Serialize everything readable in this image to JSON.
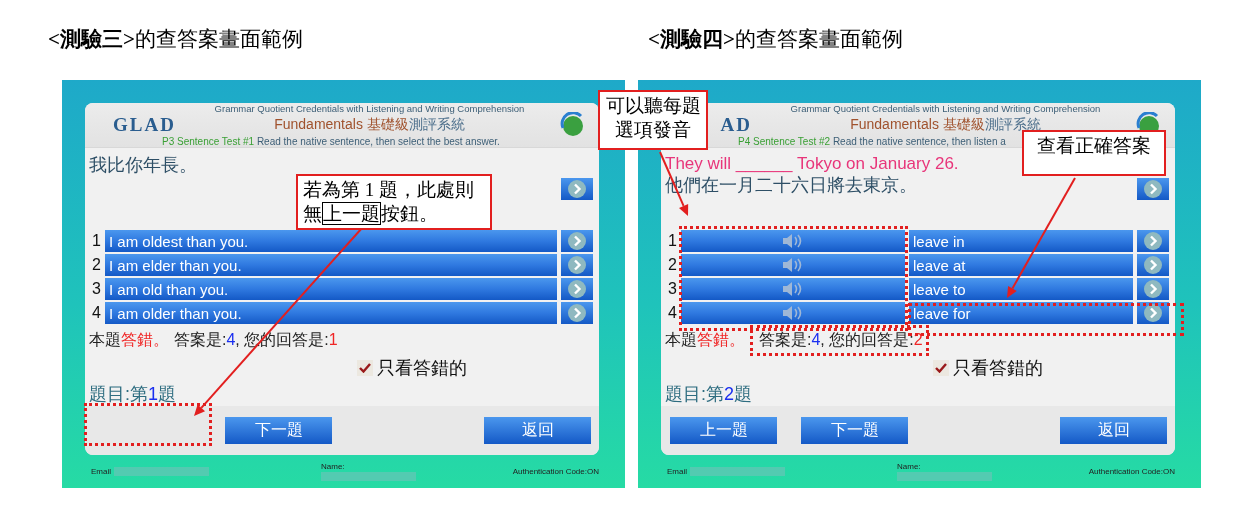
{
  "panels": [
    {
      "heading": "**<測驗三>**的查答案畫面範例",
      "app": {
        "logo": "GLAD",
        "header_line": "Grammar Quotient Credentials with Listening and Writing Comprehension",
        "title_main": "Fundamentals 基礎級",
        "title_rest": "測評系統",
        "test_name": "P3 Sentence Test #1",
        "instruction": "Read the native sentence, then select the best answer."
      },
      "question": {
        "translation": "我比你年長。"
      },
      "options": [
        {
          "number": "1",
          "text": "I am oldest than you.",
          "kind": "text"
        },
        {
          "number": "2",
          "text": "I am elder than you.",
          "kind": "text"
        },
        {
          "number": "3",
          "text": "I am old than you.",
          "kind": "text"
        },
        {
          "number": "4",
          "text": "I am older than you.",
          "kind": "text"
        }
      ],
      "result": {
        "prefix": "本題",
        "verdict": "答錯。",
        "answer_label": "答案是:",
        "answer": "4",
        "response_label": ", 您的回答是:",
        "response": "1"
      },
      "filter": {
        "label": "只看答錯的",
        "checked": true
      },
      "progress": {
        "label": "題目:第",
        "number": "1",
        "suffix": "題"
      },
      "buttons": [
        {
          "label": "下一題",
          "kind": "next"
        },
        {
          "label": "返回",
          "kind": "back"
        }
      ],
      "footer": {
        "email_label": "Email",
        "name_label": "Name:",
        "auth": "Authentication Code:ON"
      },
      "callouts": [
        {
          "parts": [
            {
              "text": "若為第 1 題，此處則無",
              "boxed": false
            },
            {
              "text": "上一題",
              "boxed": true
            },
            {
              "text": "按鈕。",
              "boxed": false
            }
          ]
        }
      ]
    },
    {
      "heading": "**<測驗四>**的查答案畫面範例",
      "app": {
        "logo": "AD",
        "header_line": "Grammar Quotient Credentials with Listening and Writing Comprehension",
        "title_main": "Fundamentals 基礎級",
        "title_rest": "測評系統",
        "test_name": "P4 Sentence Test #2",
        "instruction": "Read the native sentence, then listen a"
      },
      "question": {
        "sentence": "They will ______ Tokyo on January 26.",
        "translation": "他們在一月二十六日將去東京。"
      },
      "options": [
        {
          "number": "1",
          "text": "leave in",
          "kind": "audio"
        },
        {
          "number": "2",
          "text": "leave at",
          "kind": "audio"
        },
        {
          "number": "3",
          "text": "leave to",
          "kind": "audio"
        },
        {
          "number": "4",
          "text": "leave for",
          "kind": "audio"
        }
      ],
      "result": {
        "prefix": "本題",
        "verdict": "答錯。",
        "answer_label": "答案是:",
        "answer": "4",
        "response_label": ", 您的回答是:",
        "response": "2"
      },
      "filter": {
        "label": "只看答錯的",
        "checked": true
      },
      "progress": {
        "label": "題目:第",
        "number": "2",
        "suffix": "題"
      },
      "buttons": [
        {
          "label": "上一題",
          "kind": "prev"
        },
        {
          "label": "下一題",
          "kind": "next"
        },
        {
          "label": "返回",
          "kind": "back"
        }
      ],
      "footer": {
        "email_label": "Email",
        "name_label": "Name:",
        "auth": "Authentication Code:ON"
      },
      "callouts": [
        {
          "parts": [
            {
              "text": "可以聽每題選項發音",
              "boxed": false
            }
          ]
        },
        {
          "parts": [
            {
              "text": "查看正確答案",
              "boxed": false
            }
          ]
        }
      ]
    }
  ]
}
